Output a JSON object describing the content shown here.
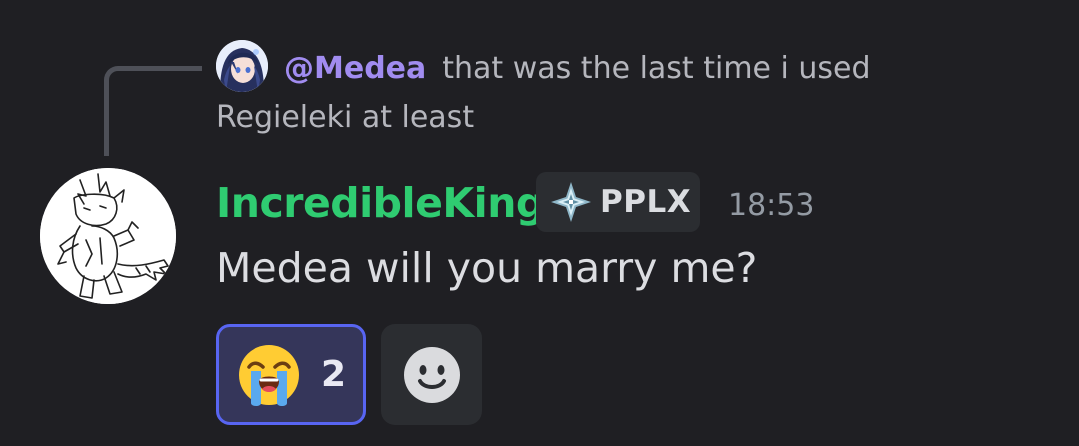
{
  "reply": {
    "mention": "@Medea",
    "text_line1": "that was the last time i used",
    "text_line2": "Regieleki at least"
  },
  "message": {
    "username": "IncredibleKing",
    "username_color": "#2fcc71",
    "tag": "PPLX",
    "tag_icon": "diamond-star-icon",
    "timestamp": "18:53",
    "content": "Medea will you marry me?"
  },
  "reactions": [
    {
      "emoji": "loudly-crying-face",
      "count": "2",
      "selected": true
    }
  ],
  "add_reaction_icon": "smiley-add-reaction-icon",
  "colors": {
    "background": "#1f1f23",
    "mention": "#a18cf0",
    "accent": "#5865f2"
  }
}
